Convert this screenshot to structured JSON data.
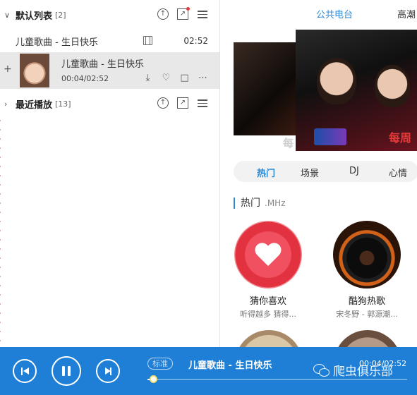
{
  "playlist": {
    "group1": {
      "name": "默认列表",
      "count": "[2]"
    },
    "song1": {
      "title": "儿童歌曲 - 生日快乐",
      "duration": "02:52"
    },
    "now_playing": {
      "title": "儿童歌曲 - 生日快乐",
      "time": "00:04/02:52"
    },
    "group2": {
      "name": "最近播放",
      "count": "[13]"
    }
  },
  "radio": {
    "tabs": [
      "公共电台",
      "高潮"
    ],
    "banner": {
      "tag": "每周",
      "stub": "每"
    },
    "categories": [
      "热门",
      "场景",
      "DJ",
      "心情"
    ],
    "section": {
      "title": "热门",
      "subtitle": ".MHz"
    },
    "cards": [
      {
        "name": "猜你喜欢",
        "desc": "听得越多 猜得..."
      },
      {
        "name": "酷狗热歌",
        "desc": "宋冬野 - 郭源潮..."
      }
    ]
  },
  "player": {
    "quality": "标准",
    "title": "儿童歌曲 - 生日快乐",
    "time": "00:04/02:52",
    "progress": 0.023
  },
  "watermark": "爬虫俱乐部",
  "colors": {
    "accent": "#1f7fd6",
    "link": "#2a8ad8",
    "love": "#e2313f"
  },
  "icons": [
    "upload-icon",
    "share-icon",
    "menu-icon",
    "mv-icon",
    "heart-icon",
    "download-icon",
    "trash-icon",
    "more-icon",
    "wechat-icon"
  ]
}
